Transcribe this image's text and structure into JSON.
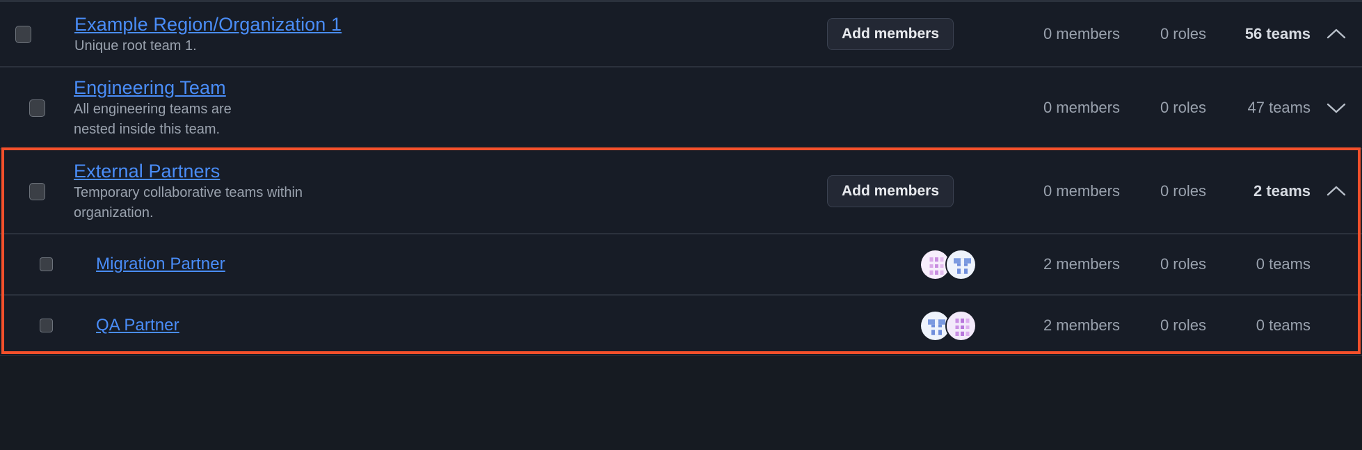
{
  "theme": {
    "background": "#161b22",
    "row_background": "#171c26",
    "link_color": "#4a8df8",
    "muted_text": "#9aa2ae",
    "strong_text": "#d7dbe2",
    "highlight_border": "#f4502b",
    "button_background": "#232834"
  },
  "labels": {
    "add_members": "Add members"
  },
  "rows": [
    {
      "name": "Example Region/Organization 1",
      "description": "Unique root team 1.",
      "indent": 0,
      "add_members": "Add members",
      "members": "0 members",
      "roles": "0 roles",
      "teams": "56 teams",
      "expanded": true,
      "chevron": "chevron-up",
      "avatars": []
    },
    {
      "name": "Engineering Team",
      "description": "All engineering teams are nested inside this team.",
      "indent": 1,
      "add_members": "",
      "members": "0 members",
      "roles": "0 roles",
      "teams": "47 teams",
      "expanded": false,
      "chevron": "chevron-down",
      "avatars": []
    },
    {
      "name": "External Partners",
      "description": "Temporary collaborative teams within organization.",
      "indent": 1,
      "add_members": "Add members",
      "members": "0 members",
      "roles": "0 roles",
      "teams": "2 teams",
      "expanded": true,
      "chevron": "chevron-up",
      "avatars": []
    },
    {
      "name": "Migration Partner",
      "description": "",
      "indent": 2,
      "add_members": "",
      "members": "2 members",
      "roles": "0 roles",
      "teams": "0 teams",
      "expanded": null,
      "chevron": "",
      "avatars": [
        "avatar-pink",
        "avatar-blue"
      ]
    },
    {
      "name": "QA Partner",
      "description": "",
      "indent": 2,
      "add_members": "",
      "members": "2 members",
      "roles": "0 roles",
      "teams": "0 teams",
      "expanded": null,
      "chevron": "",
      "avatars": [
        "avatar-blue",
        "avatar-purple"
      ]
    }
  ]
}
